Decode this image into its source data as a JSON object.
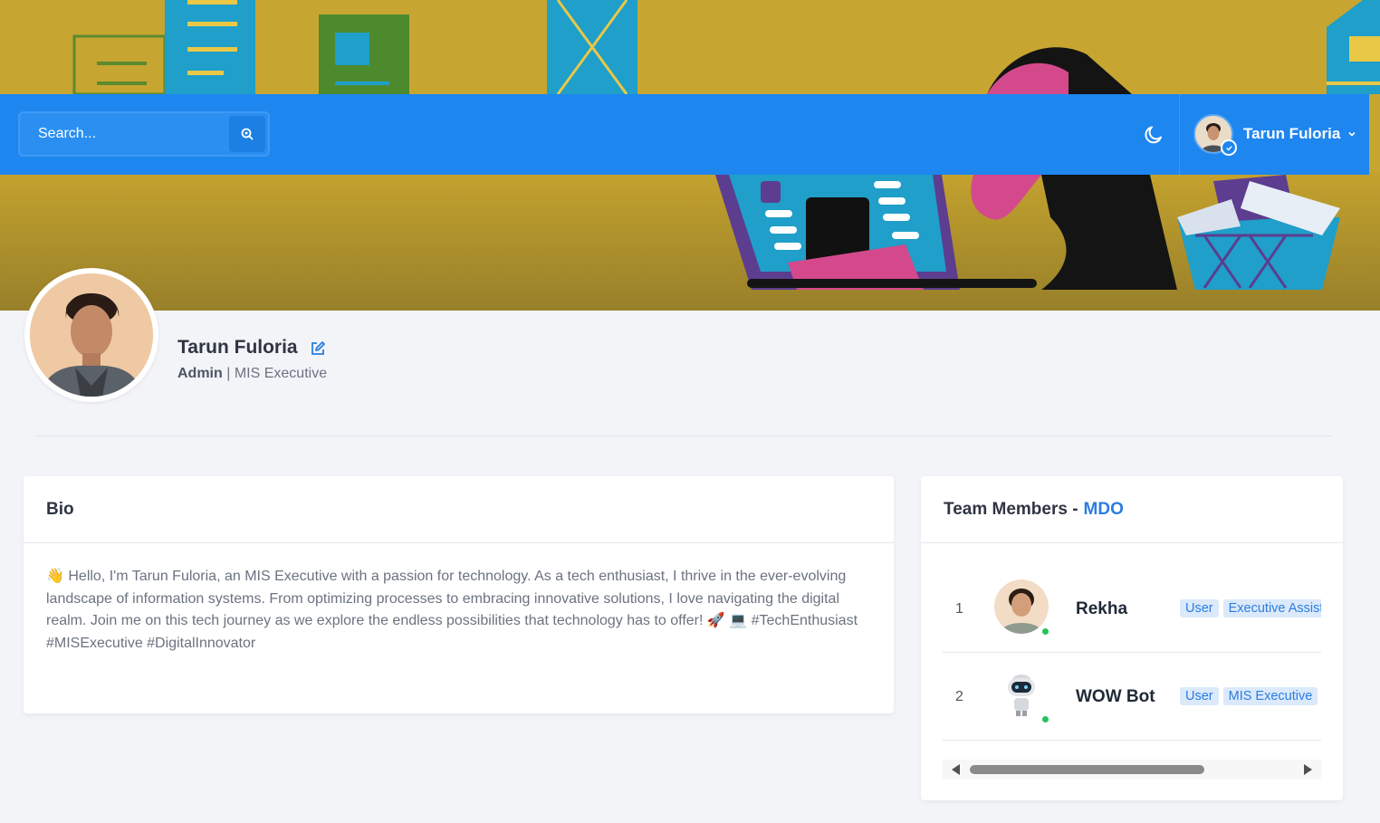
{
  "navbar": {
    "search_placeholder": "Search...",
    "username": "Tarun Fuloria"
  },
  "profile": {
    "name": "Tarun Fuloria",
    "role": "Admin",
    "separator": "|",
    "designation": "MIS Executive"
  },
  "bio": {
    "title": "Bio",
    "text": "👋 Hello, I'm Tarun Fuloria, an MIS Executive with a passion for technology. As a tech enthusiast, I thrive in the ever-evolving landscape of information systems. From optimizing processes to embracing innovative solutions, I love navigating the digital realm. Join me on this tech journey as we explore the endless possibilities that technology has to offer! 🚀 💻 #TechEnthusiast #MISExecutive #DigitalInnovator"
  },
  "team": {
    "title": "Team Members -",
    "team_name": "MDO",
    "members": [
      {
        "index": "1",
        "name": "Rekha",
        "badges": [
          "User",
          "Executive Assistant"
        ]
      },
      {
        "index": "2",
        "name": "WOW Bot",
        "badges": [
          "User",
          "MIS Executive"
        ]
      }
    ]
  },
  "colors": {
    "navbar": "#1e86ef",
    "banner": "#c7a531",
    "accent": "#2b7de0",
    "online": "#22c55e"
  }
}
